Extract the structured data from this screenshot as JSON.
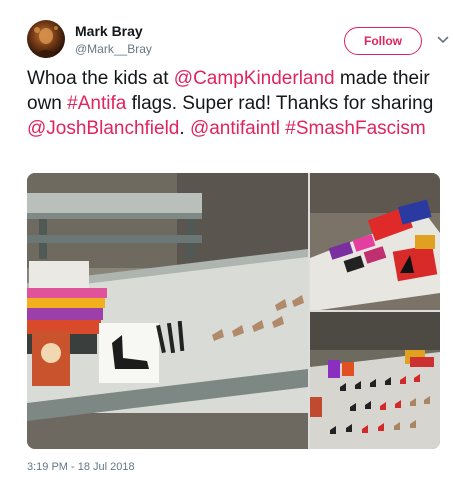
{
  "user": {
    "name": "Mark Bray",
    "handle": "@Mark__Bray"
  },
  "follow_label": "Follow",
  "tweet": {
    "seg1": "Whoa the kids at ",
    "mention1": "@CampKinderland",
    "seg2": " made their own ",
    "hashtag1": "#Antifa",
    "seg3": " flags. Super rad! Thanks for sharing ",
    "mention2": "@JoshBlanchfield",
    "seg4": ". ",
    "mention3": "@antifaintl",
    "seg5": " ",
    "hashtag2": "#SmashFascism"
  },
  "timestamp": "3:19 PM - 18 Jul 2018",
  "colors": {
    "accent": "#e0245e",
    "text": "#14171a",
    "muted": "#657786"
  },
  "icons": {
    "caret": "chevron-down-icon"
  }
}
